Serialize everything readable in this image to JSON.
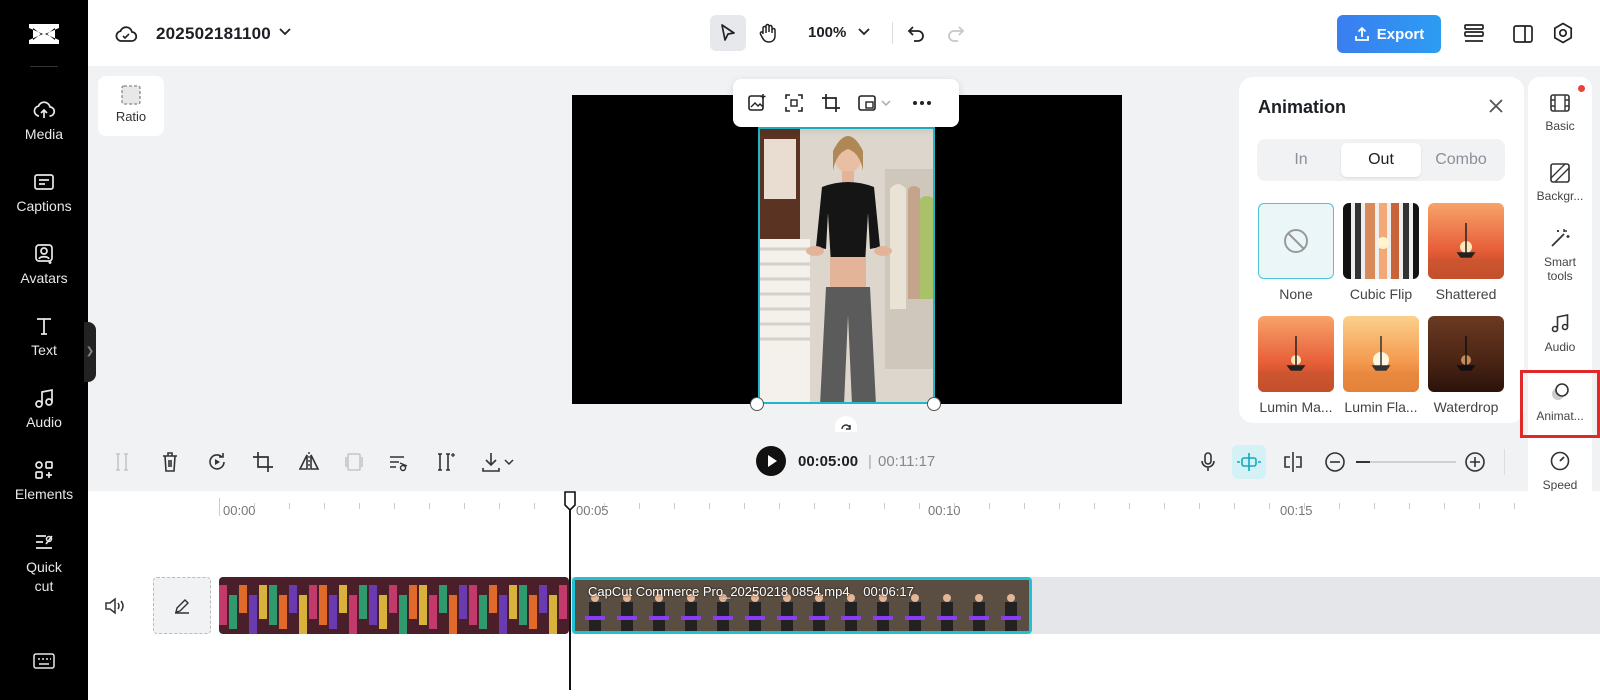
{
  "sidebar": {
    "items": [
      {
        "label": "Media",
        "icon": "cloud-upload-icon"
      },
      {
        "label": "Captions",
        "icon": "captions-icon"
      },
      {
        "label": "Avatars",
        "icon": "avatar-icon"
      },
      {
        "label": "Text",
        "icon": "text-icon"
      },
      {
        "label": "Audio",
        "icon": "music-note-icon"
      },
      {
        "label": "Elements",
        "icon": "elements-icon"
      },
      {
        "label": "Quick cut",
        "icon": "quick-cut-icon"
      }
    ]
  },
  "topbar": {
    "project_name": "202502181100",
    "zoom": "100%",
    "export_label": "Export"
  },
  "canvas": {
    "ratio_label": "Ratio"
  },
  "animation_panel": {
    "title": "Animation",
    "tabs": [
      {
        "label": "In",
        "active": false
      },
      {
        "label": "Out",
        "active": true
      },
      {
        "label": "Combo",
        "active": false
      }
    ],
    "effects": [
      {
        "label": "None"
      },
      {
        "label": "Cubic Flip"
      },
      {
        "label": "Shattered"
      },
      {
        "label": "Lumin Ma..."
      },
      {
        "label": "Lumin Fla..."
      },
      {
        "label": "Waterdrop"
      }
    ]
  },
  "right_rail": {
    "items": [
      {
        "label": "Basic"
      },
      {
        "label": "Backgr..."
      },
      {
        "label": "Smart tools"
      },
      {
        "label": "Audio"
      },
      {
        "label": "Animat..."
      },
      {
        "label": "Speed"
      }
    ]
  },
  "playback": {
    "current_time": "00:05:00",
    "separator": "|",
    "total_time": "00:11:17"
  },
  "timeline": {
    "ruler": [
      "00:00",
      "00:05",
      "00:10",
      "00:15"
    ],
    "clip2_name": "CapCut Commerce Pro_20250218 0854.mp4",
    "clip2_duration": "00:06:17"
  },
  "colors": {
    "accent": "#20c1d4",
    "export_blue": "#2d8cf0",
    "highlight_red": "#e02929"
  }
}
